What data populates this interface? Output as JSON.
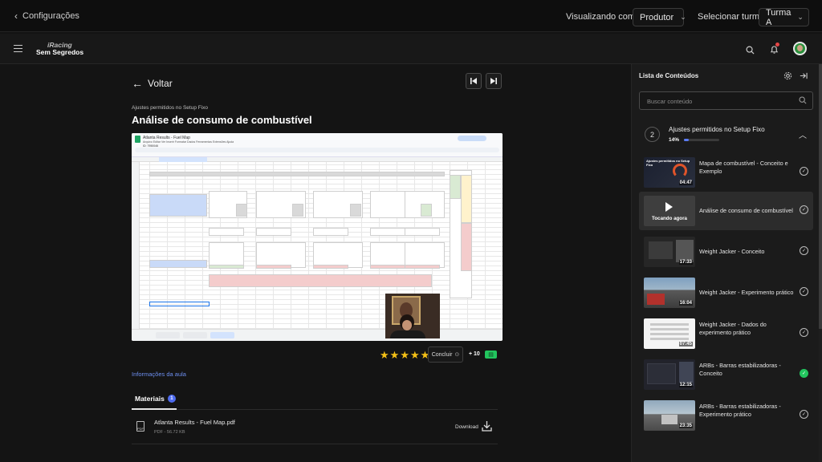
{
  "topbar": {
    "back_label": "Configurações",
    "view_as_label": "Visualizando como:",
    "view_as_value": "Produtor",
    "class_label": "Selecionar turma:",
    "class_value": "Turma A"
  },
  "navbar": {
    "logo_line1": "iRacing",
    "logo_line2": "Sem Segredos"
  },
  "lesson": {
    "back_label": "Voltar",
    "breadcrumb": "Ajustes permitidos no Setup Fixo",
    "title": "Análise de consumo de combustível",
    "rating_stars": 5,
    "complete_label": "Concluir",
    "points": "+ 10",
    "info_link": "Informações da aula"
  },
  "video_sheet": {
    "doc_title": "Atlanta Results - Fuel Map",
    "menu": "Arquivo  Editar  Ver  Inserir  Formatar  Dados  Ferramentas  Extensões  Ajuda",
    "cell_ref": "ID: 7950046",
    "share_label": "Compartilhar",
    "sheet_tabs": [
      "Página1",
      "Air Expanded",
      "Fuel Map"
    ]
  },
  "materials": {
    "tab_label": "Materiais",
    "count": "1",
    "files": [
      {
        "name": "Atlanta Results - Fuel Map.pdf",
        "meta": "PDF - 56.72 KB",
        "download_label": "Download",
        "icon_text": "PDF"
      }
    ]
  },
  "sidebar": {
    "title": "Lista de Conteúdos",
    "search_placeholder": "Buscar conteúdo",
    "module": {
      "number": "2",
      "title": "Ajustes permitidos no Setup Fixo",
      "progress_label": "14%",
      "progress": 0.14
    },
    "items": [
      {
        "title": "Mapa de combustível - Conceito e Exemplo",
        "duration": "04:47",
        "thumb_text": "Ajustes permitidos no Setup Fixo",
        "status": "pending"
      },
      {
        "title": "Análise de consumo de combustível",
        "now_playing": "Tocando agora",
        "status": "pending",
        "active": true
      },
      {
        "title": "Weight Jacker - Conceito",
        "duration": "17:33",
        "status": "pending"
      },
      {
        "title": "Weight Jacker - Experimento prático",
        "duration": "16:04",
        "status": "pending"
      },
      {
        "title": "Weight Jacker - Dados do experimento prático",
        "duration": "07:45",
        "status": "pending"
      },
      {
        "title": "ARBs - Barras estabilizadoras - Conceito",
        "duration": "12:15",
        "status": "done"
      },
      {
        "title": "ARBs - Barras estabilizadoras - Experimento prático",
        "duration": "23:35",
        "status": "pending"
      }
    ]
  },
  "icons": {
    "accent": "#5b7cf5",
    "success": "#22c55e",
    "star": "#f4c016",
    "alert_dot": "#e54646"
  }
}
